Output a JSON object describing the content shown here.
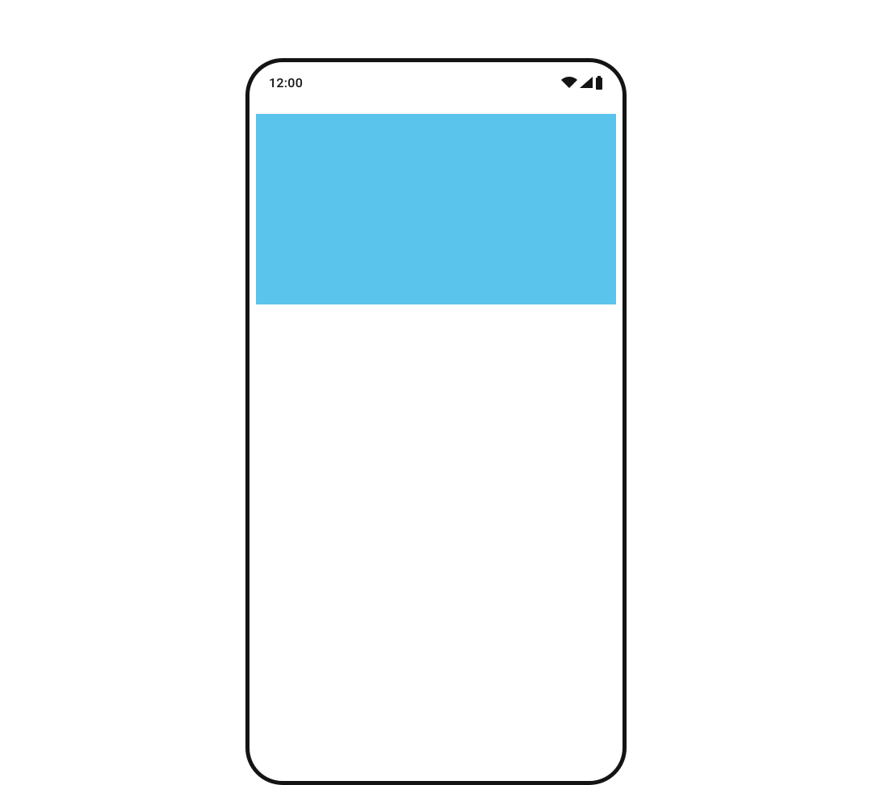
{
  "status_bar": {
    "time": "12:00",
    "icons": {
      "wifi": "wifi-icon",
      "signal": "cellular-icon",
      "battery": "battery-icon"
    }
  },
  "content": {
    "block_color": "#5bc4ed"
  }
}
